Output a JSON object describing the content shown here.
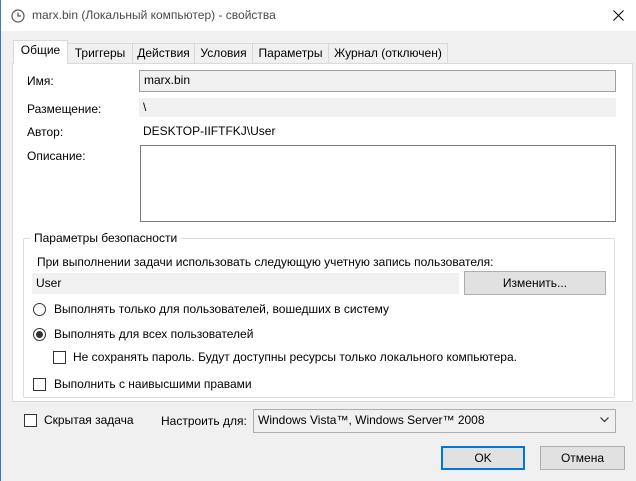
{
  "window": {
    "title": "marx.bin (Локальный компьютер) - свойства",
    "title_icon": "clock-icon",
    "close_icon": "close-icon",
    "accent": "#0078d7"
  },
  "tabs": [
    {
      "label": "Общие",
      "active": true
    },
    {
      "label": "Триггеры",
      "active": false
    },
    {
      "label": "Действия",
      "active": false
    },
    {
      "label": "Условия",
      "active": false
    },
    {
      "label": "Параметры",
      "active": false
    },
    {
      "label": "Журнал (отключен)",
      "active": false
    }
  ],
  "general": {
    "name_label": "Имя:",
    "name_value": "marx.bin",
    "location_label": "Размещение:",
    "location_value": "\\",
    "author_label": "Автор:",
    "author_value": "DESKTOP-IIFTFKJ\\User",
    "description_label": "Описание:",
    "description_value": ""
  },
  "security": {
    "group_title": "Параметры безопасности",
    "account_prompt": "При выполнении задачи использовать следующую учетную запись пользователя:",
    "account_value": "User",
    "change_button": "Изменить...",
    "radio_logged_on": "Выполнять только для пользователей, вошедших в систему",
    "radio_logged_on_checked": false,
    "radio_all_users": "Выполнять для всех пользователей",
    "radio_all_users_checked": true,
    "no_store_password": "Не сохранять пароль. Будут доступны ресурсы только локального компьютера.",
    "no_store_password_checked": false,
    "highest_privileges": "Выполнить с наивысшими правами",
    "highest_privileges_checked": false
  },
  "footer": {
    "hidden_label": "Скрытая задача",
    "hidden_checked": false,
    "configure_label": "Настроить для:",
    "configure_value": "Windows Vista™, Windows Server™ 2008",
    "ok_button": "OK",
    "cancel_button": "Отмена"
  }
}
